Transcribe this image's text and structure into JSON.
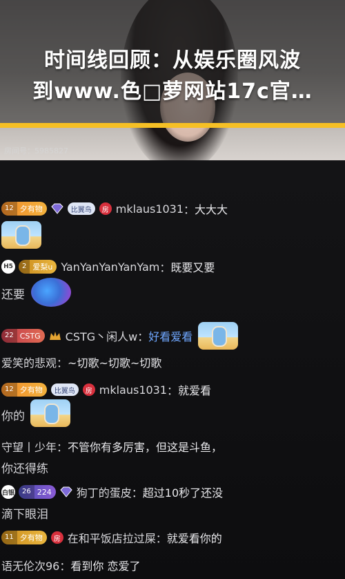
{
  "headline": {
    "line1": "时间线回顾：从娱乐圈风波",
    "line2": "到www.色□萝网站17c官…"
  },
  "video": {
    "room_id": "房间号：5985827"
  },
  "chat": {
    "messages": [
      {
        "level": "12",
        "badge": "夕有物",
        "chip": "比翼鸟",
        "room": "房",
        "nick": "mklaus1031",
        "colon": "：",
        "text": "大大大"
      },
      {
        "level": "2",
        "badge": "爱梨u",
        "pre": "H5",
        "nick": "YanYanYanYanYam",
        "colon": "：",
        "text": "既要又要",
        "cont": "还要"
      },
      {
        "level": "22",
        "badge": "CSTG",
        "nick": "CSTG丶闲人w",
        "colon": "：",
        "text": "好看爱看"
      },
      {
        "nick": "爱笑的悲观",
        "colon": "：",
        "text": "~切歌~切歌~切歌"
      },
      {
        "level": "12",
        "badge": "夕有物",
        "chip": "比翼鸟",
        "room": "房",
        "nick": "mklaus1031",
        "colon": "：",
        "text": "就爱看",
        "cont": "你的"
      },
      {
        "nick": "守望丨少年",
        "colon": "：",
        "text": "不管你有多厉害，但这是斗鱼，",
        "cont": "你还得练"
      },
      {
        "pre": "白银",
        "level": "26",
        "badge": "224",
        "nick": "狗丁的蛋皮",
        "colon": "：",
        "text": "超过10秒了还没",
        "cont": "滴下眼泪"
      },
      {
        "level": "11",
        "badge": "夕有物",
        "room": "房",
        "nick": "在和平饭店拉过屎",
        "colon": "：",
        "text": "就爱看你的"
      },
      {
        "nick": "语无伦次96",
        "colon": "：",
        "text": "看到你 恋爱了"
      }
    ]
  },
  "colors": {
    "accent_bar": "#f6c025",
    "mention_blue": "#6fa7ff"
  }
}
